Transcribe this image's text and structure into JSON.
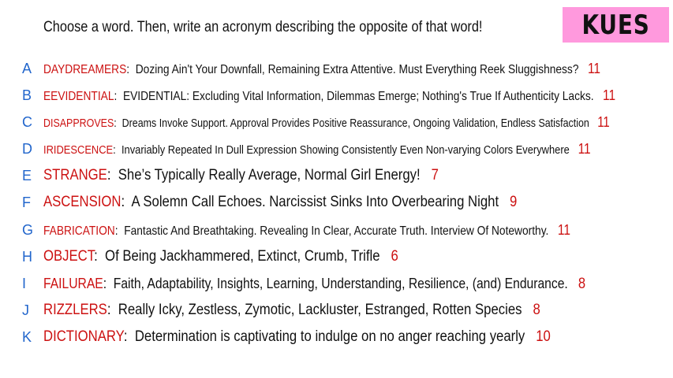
{
  "prompt": "Choose a word. Then, write an acronym describing the opposite of that word!",
  "badge": {
    "text": "KUES",
    "color": "#ff99dd"
  },
  "colors": {
    "letter": "#2266cc",
    "word": "#cc1111",
    "text": "#111111"
  },
  "items": [
    {
      "letter": "A",
      "word": "DAYDREAMERS",
      "acronym": "Dozing Ain't Your Downfall, Remaining Extra Attentive. Must Everything Reek Sluggishness?",
      "count": "11"
    },
    {
      "letter": "B",
      "word": "EEVIDENTIAL",
      "acronym": "EVIDENTIAL: Excluding Vital Information, Dilemmas Emerge; Nothing's True If Authenticity Lacks.",
      "count": "11"
    },
    {
      "letter": "C",
      "word": "DISAPPROVES",
      "acronym": "Dreams Invoke Support. Approval Provides Positive Reassurance, Ongoing Validation, Endless Satisfaction",
      "count": "11"
    },
    {
      "letter": "D",
      "word": "IRIDESCENCE",
      "acronym": "Invariably Repeated In Dull Expression Showing Consistently Even Non-varying Colors Everywhere",
      "count": "11"
    },
    {
      "letter": "E",
      "word": "STRANGE",
      "acronym": "She’s Typically Really Average, Normal Girl Energy!",
      "count": "7"
    },
    {
      "letter": "F",
      "word": "ASCENSION",
      "acronym": "A Solemn Call Echoes. Narcissist Sinks Into Overbearing Night",
      "count": "9"
    },
    {
      "letter": "G",
      "word": "FABRICATION",
      "acronym": "Fantastic And Breathtaking. Revealing In Clear, Accurate Truth. Interview Of Noteworthy.",
      "count": "11"
    },
    {
      "letter": "H",
      "word": "OBJECT",
      "acronym": "Of Being Jackhammered, Extinct, Crumb, Trifle",
      "count": "6"
    },
    {
      "letter": "I",
      "word": "FAILURAE",
      "acronym": "Faith, Adaptability, Insights, Learning, Understanding, Resilience, (and) Endurance.",
      "count": "8"
    },
    {
      "letter": "J",
      "word": "RIZZLERS",
      "acronym": "Really Icky, Zestless, Zymotic, Lackluster, Estranged, Rotten Species",
      "count": "8"
    },
    {
      "letter": "K",
      "word": "DICTIONARY",
      "acronym": "Determination is captivating to indulge on no anger reaching yearly",
      "count": "10"
    }
  ]
}
